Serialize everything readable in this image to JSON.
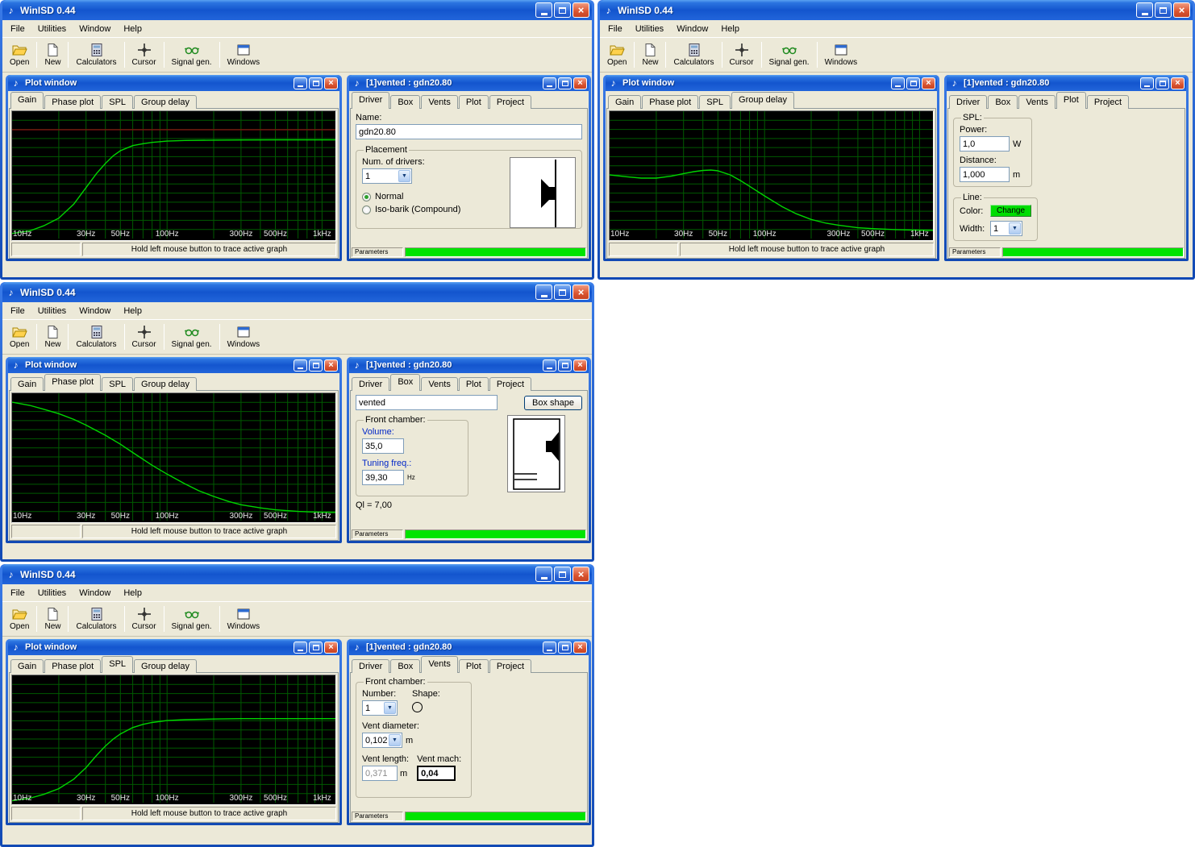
{
  "icons": {
    "app_glyph": "♪",
    "close_glyph": "×",
    "dropdown_glyph": "▼"
  },
  "app": {
    "title": "WinISD 0.44",
    "menus": [
      "File",
      "Utilities",
      "Window",
      "Help"
    ],
    "toolbar": [
      "Open",
      "New",
      "Calculators",
      "Cursor",
      "Signal gen.",
      "Windows"
    ]
  },
  "plot_window": {
    "title": "Plot window",
    "tabs": [
      "Gain",
      "Phase plot",
      "SPL",
      "Group delay"
    ],
    "status_text": "Hold left mouse button to trace active graph"
  },
  "vented_window": {
    "title": "[1]vented : gdn20.80",
    "tabs": [
      "Driver",
      "Box",
      "Vents",
      "Plot",
      "Project"
    ],
    "parameters_label": "Parameters"
  },
  "driver_tab": {
    "name_label": "Name:",
    "name_value": "gdn20.80",
    "placement_label": "Placement",
    "num_drivers_label": "Num. of drivers:",
    "num_drivers_value": "1",
    "radio_normal": "Normal",
    "radio_isobarik": "Iso-barik (Compound)"
  },
  "plot_tab": {
    "spl_label": "SPL:",
    "power_label": "Power:",
    "power_value": "1,0",
    "power_unit": "W",
    "distance_label": "Distance:",
    "distance_value": "1,000",
    "distance_unit": "m",
    "line_label": "Line:",
    "color_label": "Color:",
    "color_button": "Change",
    "color_button_color": "#00dd00",
    "width_label": "Width:",
    "width_value": "1"
  },
  "box_tab": {
    "type_value": "vented",
    "box_shape_button": "Box shape",
    "front_chamber_label": "Front chamber:",
    "volume_label": "Volume:",
    "volume_value": "35,0",
    "tuning_label": "Tuning freq.:",
    "tuning_value": "39,30",
    "tuning_unit": "Hz",
    "ql_text": "Ql = 7,00"
  },
  "vents_tab": {
    "front_chamber_label": "Front chamber:",
    "number_label": "Number:",
    "number_value": "1",
    "shape_label": "Shape:",
    "vent_diameter_label": "Vent diameter:",
    "vent_diameter_value": "0,102",
    "vent_diameter_unit": "m",
    "vent_length_label": "Vent length:",
    "vent_length_value": "0,371",
    "vent_length_unit": "m",
    "vent_mach_label": "Vent mach:",
    "vent_mach_value": "0,04"
  },
  "windows_state": [
    {
      "plot_active_tab": "Gain",
      "vented_active_tab": "Driver"
    },
    {
      "plot_active_tab": "Group delay",
      "vented_active_tab": "Plot"
    },
    {
      "plot_active_tab": "Phase plot",
      "vented_active_tab": "Box"
    },
    {
      "plot_active_tab": "SPL",
      "vented_active_tab": "Vents"
    }
  ],
  "chart_data": [
    {
      "type": "line",
      "title": "Gain",
      "x_scale": "log",
      "f_range": [
        10,
        1250
      ],
      "note": "y values are fraction of plot height from top; no y-axis labels visible in screenshot",
      "x_ticks": [
        {
          "f": 10,
          "label": "10Hz"
        },
        {
          "f": 30,
          "label": "30Hz"
        },
        {
          "f": 50,
          "label": "50Hz"
        },
        {
          "f": 100,
          "label": "100Hz"
        },
        {
          "f": 300,
          "label": "300Hz"
        },
        {
          "f": 500,
          "label": "500Hz"
        },
        {
          "f": 1000,
          "label": "1kHz"
        }
      ],
      "grid_color": "#005a00",
      "curve_color": "#00d400",
      "ref_lines": [
        {
          "y": 0.145,
          "color": "#801010"
        }
      ],
      "curve": [
        [
          10,
          0.96
        ],
        [
          13,
          0.94
        ],
        [
          16,
          0.9
        ],
        [
          20,
          0.84
        ],
        [
          25,
          0.73
        ],
        [
          30,
          0.6
        ],
        [
          35,
          0.49
        ],
        [
          40,
          0.41
        ],
        [
          45,
          0.35
        ],
        [
          50,
          0.31
        ],
        [
          60,
          0.27
        ],
        [
          70,
          0.255
        ],
        [
          80,
          0.245
        ],
        [
          100,
          0.235
        ],
        [
          130,
          0.23
        ],
        [
          200,
          0.227
        ],
        [
          300,
          0.226
        ],
        [
          500,
          0.225
        ],
        [
          800,
          0.225
        ],
        [
          1250,
          0.225
        ]
      ]
    },
    {
      "type": "line",
      "title": "Group delay",
      "x_scale": "log",
      "f_range": [
        10,
        1250
      ],
      "note": "y values are fraction of plot height from top",
      "x_ticks": [
        {
          "f": 10,
          "label": "10Hz"
        },
        {
          "f": 30,
          "label": "30Hz"
        },
        {
          "f": 50,
          "label": "50Hz"
        },
        {
          "f": 100,
          "label": "100Hz"
        },
        {
          "f": 300,
          "label": "300Hz"
        },
        {
          "f": 500,
          "label": "500Hz"
        },
        {
          "f": 1000,
          "label": "1kHz"
        }
      ],
      "grid_color": "#005a00",
      "curve_color": "#00d400",
      "ref_lines": [],
      "curve": [
        [
          10,
          0.5
        ],
        [
          13,
          0.515
        ],
        [
          16,
          0.525
        ],
        [
          20,
          0.525
        ],
        [
          25,
          0.51
        ],
        [
          30,
          0.49
        ],
        [
          35,
          0.475
        ],
        [
          40,
          0.465
        ],
        [
          45,
          0.462
        ],
        [
          50,
          0.468
        ],
        [
          60,
          0.5
        ],
        [
          70,
          0.545
        ],
        [
          80,
          0.59
        ],
        [
          100,
          0.665
        ],
        [
          130,
          0.75
        ],
        [
          160,
          0.805
        ],
        [
          200,
          0.85
        ],
        [
          250,
          0.88
        ],
        [
          300,
          0.895
        ],
        [
          400,
          0.915
        ],
        [
          500,
          0.922
        ],
        [
          700,
          0.93
        ],
        [
          1000,
          0.935
        ],
        [
          1250,
          0.937
        ]
      ]
    },
    {
      "type": "line",
      "title": "Phase plot",
      "x_scale": "log",
      "f_range": [
        10,
        1250
      ],
      "note": "y values are fraction of plot height from top",
      "x_ticks": [
        {
          "f": 10,
          "label": "10Hz"
        },
        {
          "f": 30,
          "label": "30Hz"
        },
        {
          "f": 50,
          "label": "50Hz"
        },
        {
          "f": 100,
          "label": "100Hz"
        },
        {
          "f": 300,
          "label": "300Hz"
        },
        {
          "f": 500,
          "label": "500Hz"
        },
        {
          "f": 1000,
          "label": "1kHz"
        }
      ],
      "grid_color": "#005a00",
      "curve_color": "#00d400",
      "ref_lines": [],
      "curve": [
        [
          10,
          0.07
        ],
        [
          13,
          0.095
        ],
        [
          16,
          0.125
        ],
        [
          20,
          0.16
        ],
        [
          25,
          0.205
        ],
        [
          30,
          0.25
        ],
        [
          40,
          0.33
        ],
        [
          50,
          0.4
        ],
        [
          60,
          0.465
        ],
        [
          80,
          0.565
        ],
        [
          100,
          0.635
        ],
        [
          130,
          0.71
        ],
        [
          160,
          0.765
        ],
        [
          200,
          0.81
        ],
        [
          250,
          0.85
        ],
        [
          300,
          0.875
        ],
        [
          400,
          0.9
        ],
        [
          500,
          0.915
        ],
        [
          700,
          0.928
        ],
        [
          1000,
          0.935
        ],
        [
          1250,
          0.937
        ]
      ]
    },
    {
      "type": "line",
      "title": "SPL",
      "x_scale": "log",
      "f_range": [
        10,
        1250
      ],
      "note": "y values are fraction of plot height from top",
      "x_ticks": [
        {
          "f": 10,
          "label": "10Hz"
        },
        {
          "f": 30,
          "label": "30Hz"
        },
        {
          "f": 50,
          "label": "50Hz"
        },
        {
          "f": 100,
          "label": "100Hz"
        },
        {
          "f": 300,
          "label": "300Hz"
        },
        {
          "f": 500,
          "label": "500Hz"
        },
        {
          "f": 1000,
          "label": "1kHz"
        }
      ],
      "grid_color": "#005a00",
      "curve_color": "#00d400",
      "ref_lines": [],
      "curve": [
        [
          10,
          0.985
        ],
        [
          13,
          0.965
        ],
        [
          16,
          0.935
        ],
        [
          20,
          0.89
        ],
        [
          25,
          0.815
        ],
        [
          30,
          0.725
        ],
        [
          35,
          0.63
        ],
        [
          40,
          0.555
        ],
        [
          45,
          0.5
        ],
        [
          50,
          0.46
        ],
        [
          60,
          0.41
        ],
        [
          70,
          0.385
        ],
        [
          80,
          0.37
        ],
        [
          100,
          0.355
        ],
        [
          130,
          0.348
        ],
        [
          200,
          0.343
        ],
        [
          300,
          0.34
        ],
        [
          500,
          0.34
        ],
        [
          800,
          0.34
        ],
        [
          1250,
          0.34
        ]
      ]
    }
  ]
}
